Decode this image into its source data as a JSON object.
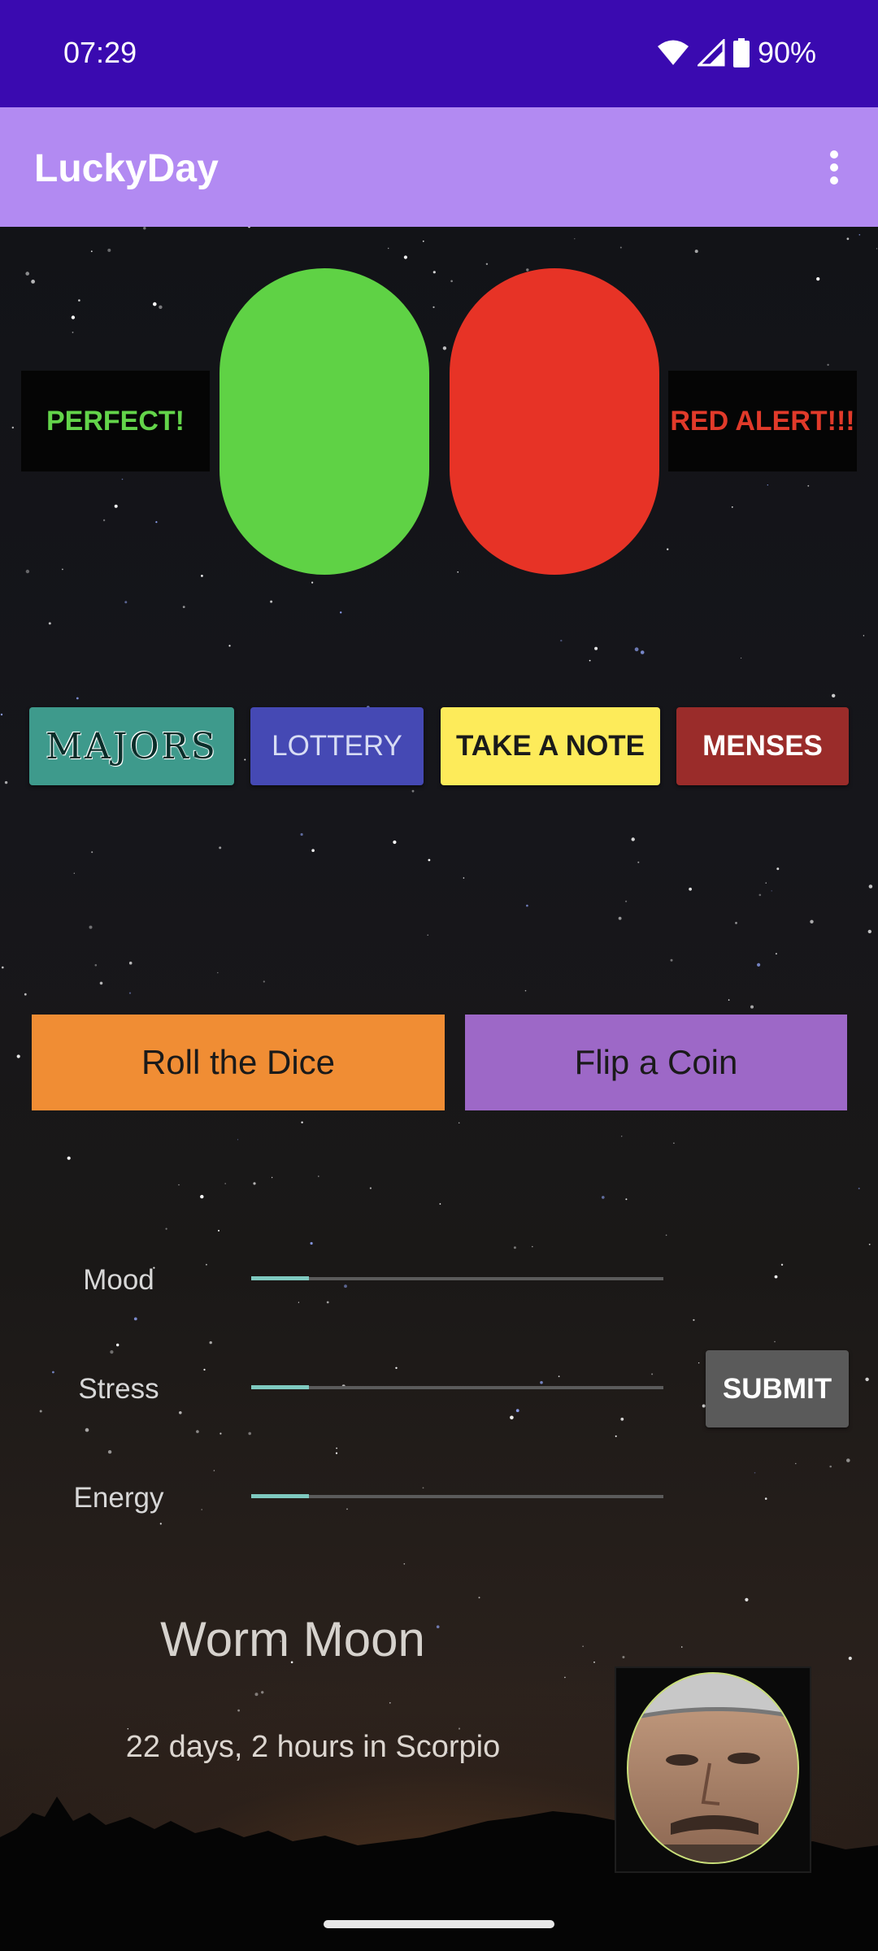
{
  "status_bar": {
    "time": "07:29",
    "battery": "90%"
  },
  "app_bar": {
    "title": "LuckyDay"
  },
  "indicators": {
    "perfect": "PERFECT!",
    "red_alert": "RED ALERT!!!"
  },
  "buttons": {
    "majors": "MAJORS",
    "lottery": "LOTTERY",
    "take_note": "TAKE A NOTE",
    "menses": "MENSES",
    "roll_dice": "Roll the Dice",
    "flip_coin": "Flip a Coin",
    "submit": "SUBMIT"
  },
  "sliders": [
    {
      "label": "Mood",
      "value_fraction": 0.14
    },
    {
      "label": "Stress",
      "value_fraction": 0.14
    },
    {
      "label": "Energy",
      "value_fraction": 0.14
    }
  ],
  "moon": {
    "name": "Worm Moon",
    "sign_text": "22 days, 2 hours in Scorpio"
  },
  "colors": {
    "status_bar": "#3a0ab0",
    "app_bar": "#b28af2",
    "green_pill": "#5fd245",
    "red_pill": "#e73326",
    "slider_fill": "#7fcac0"
  },
  "icons": [
    "wifi-icon",
    "signal-icon",
    "battery-icon",
    "overflow-menu-icon",
    "avatar-photo"
  ]
}
